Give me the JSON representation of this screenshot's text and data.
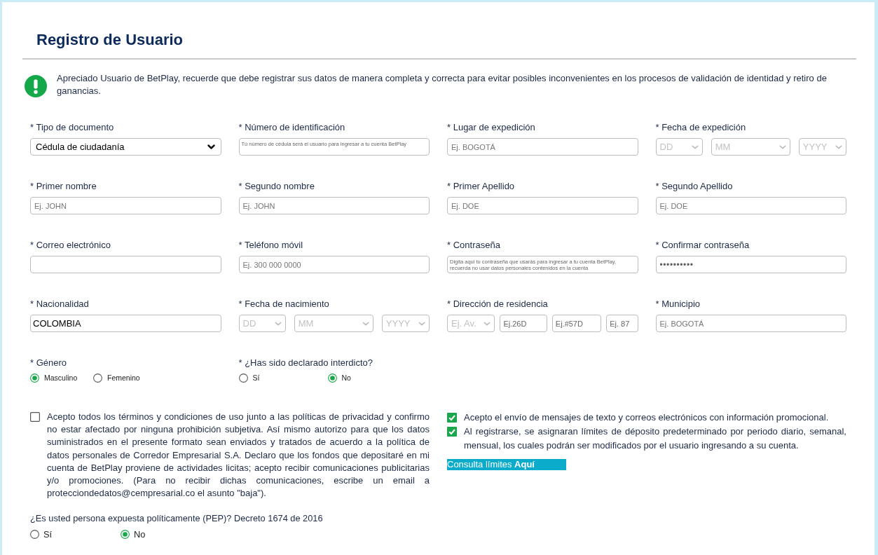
{
  "page": {
    "title": "Registro de Usuario"
  },
  "notice": {
    "text": "Apreciado Usuario de BetPlay, recuerde que debe registrar sus datos de manera completa y correcta para evitar posibles inconvenientes en los procesos de validación de identidad y retiro de ganancias."
  },
  "fields": [
    {
      "kind": "select",
      "label": "* Tipo de documento",
      "value": "Cédula de ciudadanía"
    },
    {
      "kind": "note",
      "label": "* Número de identificación",
      "placeholder": "Tú número de cédula será el usuario para ingresar a tu cuenta BetPlay"
    },
    {
      "kind": "text",
      "label": "* Lugar de expedición",
      "placeholder": "Ej. BOGOTÁ"
    },
    {
      "kind": "date",
      "label": "* Fecha de expedición",
      "parts": [
        {
          "kind": "select",
          "placeholder": "DD"
        },
        {
          "kind": "select",
          "placeholder": "MM"
        },
        {
          "kind": "select",
          "placeholder": "YYYY"
        }
      ]
    },
    {
      "kind": "text",
      "label": "* Primer nombre",
      "placeholder": "Ej. JOHN"
    },
    {
      "kind": "text",
      "label": "* Segundo nombre",
      "placeholder": "Ej. JOHN"
    },
    {
      "kind": "text",
      "label": "* Primer Apellido",
      "placeholder": "Ej. DOE"
    },
    {
      "kind": "text",
      "label": "* Segundo Apellido",
      "placeholder": "Ej. DOE"
    },
    {
      "kind": "text",
      "label": "* Correo electrónico"
    },
    {
      "kind": "text",
      "label": "* Teléfono móvil",
      "placeholder": "Ej. 300 000 0000"
    },
    {
      "kind": "note",
      "label": "* Contraseña",
      "placeholder": "Digita aqui tu contraseña que usarás para ingresar a tu cuenta BetPlay, recuerda no usar datos personales contenidos en la cuenta"
    },
    {
      "kind": "password",
      "label": "* Confirmar contraseña",
      "value": "••••••••••"
    },
    {
      "kind": "text",
      "label": "* Nacionalidad",
      "value": "COLOMBIA"
    },
    {
      "kind": "date",
      "label": "* Fecha de nacimiento",
      "parts": [
        {
          "kind": "select",
          "placeholder": "DD"
        },
        {
          "kind": "select",
          "placeholder": "MM"
        },
        {
          "kind": "select",
          "placeholder": "YYYY"
        }
      ]
    },
    {
      "kind": "address",
      "label": "* Dirección de residencia",
      "parts": [
        {
          "kind": "select",
          "placeholder": "Ej. Av."
        },
        {
          "kind": "text",
          "placeholder": "Ej.26D"
        },
        {
          "kind": "text",
          "placeholder": "Ej.#57D"
        },
        {
          "kind": "text",
          "placeholder": "Ej. 87"
        }
      ]
    },
    {
      "kind": "text",
      "label": "* Municipio",
      "placeholder": "Ej. BOGOTÁ"
    },
    {
      "kind": "radio",
      "label": "* Género",
      "options": [
        {
          "label": "Masculino",
          "selected": true
        },
        {
          "label": "Femenino",
          "selected": false
        }
      ]
    },
    {
      "kind": "radio",
      "label": "* ¿Has sido declarado interdicto?",
      "options": [
        {
          "label": "Sí",
          "selected": false
        },
        {
          "label": "No",
          "selected": true
        }
      ]
    }
  ],
  "consents": [
    {
      "text": "Acepto todos los términos y condiciones de uso junto a las políticas de privacidad y confirmo no estar afectado por ninguna prohibición subjetiva. Así mismo autorizo para que los datos suministrados en el presente formato sean enviados y tratados de acuerdo a la política de datos personales de Corredor Empresarial S.A. Declaro que los fondos que depositaré en mi cuenta de BetPlay proviene de actividades licitas; acepto recibir comunicaciones publicitarias y/o promociones. (Para no recibir dichas comunicaciones, escribe un email a protecciondedatos@cempresarial.co el asunto \"baja\").",
      "checked": false
    },
    {
      "text": "Acepto el envío de mensajes de texto y correos electrónicos con información promocional.",
      "checked": true
    },
    {
      "text": "Al registrarse, se asignaran límites de déposito predeterminado por periodo diario, semanal, mensual, los cuales podrán ser modificados por el usuario ingresando a su cuenta.",
      "checked": true
    }
  ],
  "limits_link": {
    "text": "Consulta límites **Aquí**"
  },
  "pep": {
    "question": "¿Es usted persona expuesta políticamente (PEP)? Decreto 1674 de 2016",
    "options": [
      {
        "label": "Sí",
        "selected": false
      },
      {
        "label": "No",
        "selected": true
      }
    ]
  }
}
